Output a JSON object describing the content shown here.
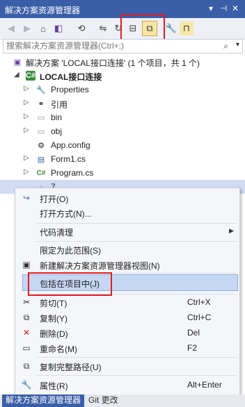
{
  "window": {
    "title": "解决方案资源管理器",
    "controls": [
      "▾",
      "⊣",
      "✕"
    ]
  },
  "toolbar": {
    "buttons": [
      {
        "icon": "back-arrow-icon",
        "glyph": "◀"
      },
      {
        "icon": "forward-arrow-icon",
        "glyph": "▶"
      },
      {
        "icon": "home-icon",
        "glyph": "⌂"
      },
      {
        "icon": "vs-switch-views-icon",
        "glyph": "◧"
      },
      {
        "icon": "history-icon",
        "glyph": "⟲"
      },
      {
        "icon": "sync-icon",
        "glyph": "⇋"
      },
      {
        "icon": "refresh-icon",
        "glyph": "↻"
      },
      {
        "icon": "collapse-all-icon",
        "glyph": "⊟"
      },
      {
        "icon": "show-all-files-icon",
        "glyph": "⧉"
      },
      {
        "icon": "properties-wrench-icon",
        "glyph": "🔧"
      },
      {
        "icon": "preview-icon",
        "glyph": "⊓"
      }
    ]
  },
  "search": {
    "placeholder": "搜索解决方案资源管理器(Ctrl+;)"
  },
  "tree": [
    {
      "label": "解决方案 'LOCAL接口连接' (1 个项目，共 1 个)",
      "icon": "solution-icon",
      "glyph": "▣"
    },
    {
      "label": "LOCAL接口连接",
      "icon": "csharp-project-icon",
      "glyph": "C#",
      "bold": true
    },
    {
      "label": "Properties",
      "icon": "wrench-icon",
      "glyph": "🔧"
    },
    {
      "label": "引用",
      "icon": "references-icon",
      "glyph": "⚭"
    },
    {
      "label": "bin",
      "icon": "folder-icon",
      "glyph": "▭"
    },
    {
      "label": "obj",
      "icon": "folder-icon",
      "glyph": "▭"
    },
    {
      "label": "App.config",
      "icon": "config-file-icon",
      "glyph": "⚙"
    },
    {
      "label": "Form1.cs",
      "icon": "form-file-icon",
      "glyph": "▤"
    },
    {
      "label": "Program.cs",
      "icon": "csharp-file-icon",
      "glyph": "C#"
    },
    {
      "label": "7",
      "icon": "file-icon",
      "glyph": "▫"
    }
  ],
  "context_menu": [
    {
      "label": "打开(O)",
      "icon": "open-icon",
      "glyph": "↪"
    },
    {
      "label": "打开方式(N)..."
    },
    {
      "sep": true
    },
    {
      "label": "代码清理",
      "submenu": true
    },
    {
      "sep": true
    },
    {
      "label": "限定为此范围(S)"
    },
    {
      "label": "新建解决方案资源管理器视图(N)",
      "icon": "new-view-icon",
      "glyph": "▣"
    },
    {
      "sep": true
    },
    {
      "label": "包括在项目中(J)",
      "highlight": true
    },
    {
      "sep": true
    },
    {
      "label": "剪切(T)",
      "shortcut": "Ctrl+X",
      "icon": "cut-icon",
      "glyph": "✂"
    },
    {
      "label": "复制(Y)",
      "shortcut": "Ctrl+C",
      "icon": "copy-icon",
      "glyph": "⧉"
    },
    {
      "label": "删除(D)",
      "shortcut": "Del",
      "icon": "delete-icon",
      "glyph": "✕"
    },
    {
      "label": "重命名(M)",
      "shortcut": "F2",
      "icon": "rename-icon",
      "glyph": "▭"
    },
    {
      "sep": true
    },
    {
      "label": "复制完整路径(U)",
      "icon": "copy-path-icon",
      "glyph": "⧉"
    },
    {
      "sep": true
    },
    {
      "label": "属性(R)",
      "shortcut": "Alt+Enter",
      "icon": "properties-wrench-icon",
      "glyph": "🔧"
    }
  ],
  "tabs": [
    {
      "label": "解决方案资源管理器",
      "active": true
    },
    {
      "label": "Git 更改",
      "active": false
    }
  ],
  "colors": {
    "accent": "#3a5fa8",
    "highlight_box": "#e21b1b",
    "selected_item": "#c5d7f2"
  }
}
